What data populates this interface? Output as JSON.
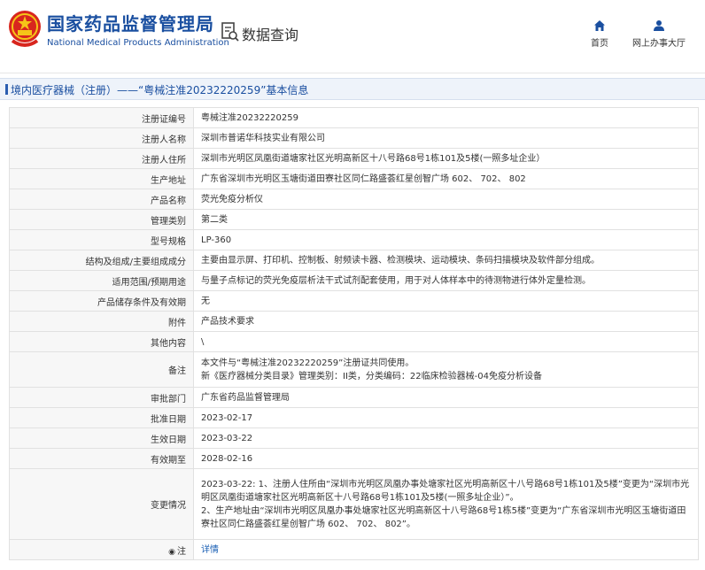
{
  "header": {
    "logo_cn": "国家药品监督管理局",
    "logo_en": "National Medical Products Administration",
    "query_label": "数据查询",
    "nav": {
      "home": "首页",
      "office": "网上办事大厅"
    }
  },
  "title": "境内医疗器械（注册）——“粤械注准20232220259”基本信息",
  "rows": [
    {
      "label": "注册证编号",
      "value": "粤械注准20232220259"
    },
    {
      "label": "注册人名称",
      "value": "深圳市普诺华科技实业有限公司"
    },
    {
      "label": "注册人住所",
      "value": "深圳市光明区凤凰街道塘家社区光明高新区十八号路68号1栋101及5楼(一照多址企业）"
    },
    {
      "label": "生产地址",
      "value": "广东省深圳市光明区玉塘街道田寮社区同仁路盛荟红星创智广场 602、 702、 802"
    },
    {
      "label": "产品名称",
      "value": "荧光免疫分析仪"
    },
    {
      "label": "管理类别",
      "value": "第二类"
    },
    {
      "label": "型号规格",
      "value": "LP-360"
    },
    {
      "label": "结构及组成/主要组成成分",
      "value": "主要由显示屏、打印机、控制板、射频读卡器、检测模块、运动模块、条码扫描模块及软件部分组成。"
    },
    {
      "label": "适用范围/预期用途",
      "value": "与量子点标记的荧光免疫层析法干式试剂配套使用，用于对人体样本中的待测物进行体外定量检测。"
    },
    {
      "label": "产品储存条件及有效期",
      "value": "无"
    },
    {
      "label": "附件",
      "value": "产品技术要求"
    },
    {
      "label": "其他内容",
      "value": "\\"
    },
    {
      "label": "备注",
      "lines": [
        "本文件与“粤械注准20232220259”注册证共同使用。",
        "新《医疗器械分类目录》管理类别：II类，分类编码：22临床检验器械-04免疫分析设备"
      ]
    },
    {
      "label": "审批部门",
      "value": "广东省药品监督管理局"
    },
    {
      "label": "批准日期",
      "value": "2023-02-17"
    },
    {
      "label": "生效日期",
      "value": "2023-03-22"
    },
    {
      "label": "有效期至",
      "value": "2028-02-16"
    },
    {
      "label": "变更情况",
      "lines": [
        "2023-03-22: 1、注册人住所由“深圳市光明区凤凰办事处塘家社区光明高新区十八号路68号1栋101及5楼”变更为“深圳市光明区凤凰街道塘家社区光明高新区十八号路68号1栋101及5楼(一照多址企业）”。",
        "2、生产地址由“深圳市光明区凤凰办事处塘家社区光明高新区十八号路68号1栋5楼”变更为“广东省深圳市光明区玉塘街道田寮社区同仁路盛荟红星创智广场 602、 702、 802”。"
      ]
    },
    {
      "label": "注",
      "value": "详情"
    }
  ]
}
